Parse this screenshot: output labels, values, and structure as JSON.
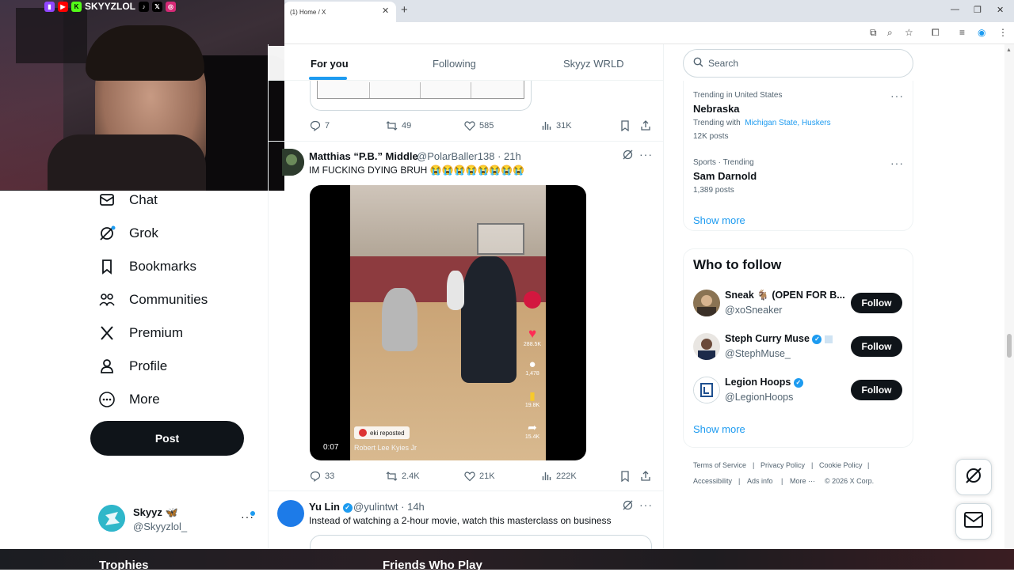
{
  "browser": {
    "tab_title": "(1) Home / X",
    "close_glyph": "✕",
    "new_tab_glyph": "+"
  },
  "stream_overlay": {
    "channel": "SKYYZLOL"
  },
  "nav": {
    "items": [
      {
        "label": "Chat",
        "icon": "chat-icon"
      },
      {
        "label": "Grok",
        "icon": "grok-icon"
      },
      {
        "label": "Bookmarks",
        "icon": "bookmark-icon"
      },
      {
        "label": "Communities",
        "icon": "communities-icon"
      },
      {
        "label": "Premium",
        "icon": "x-logo-icon"
      },
      {
        "label": "Profile",
        "icon": "profile-icon"
      },
      {
        "label": "More",
        "icon": "more-circle-icon"
      }
    ],
    "post_label": "Post",
    "account": {
      "name": "Skyyz 🦋",
      "handle": "@Skyyzlol_"
    }
  },
  "feed": {
    "tabs": [
      "For you",
      "Following",
      "Skyyz WRLD"
    ],
    "active_tab": "For you",
    "prev_post_stats": {
      "replies": "7",
      "reposts": "49",
      "likes": "585",
      "views": "31K"
    },
    "post1": {
      "author": "Matthias “P.B.” Middle",
      "handle": "@PolarBaller138 · 21h",
      "text": "IM FUCKING DYING BRUH 😭😭😭😭😭😭😭😭",
      "video": {
        "time": "0:07",
        "repost_label": "eki reposted",
        "caption": "Robert Lee Kyies Jr",
        "likes": "288.5K",
        "comments": "1,478",
        "saves": "19.8K",
        "shares": "15.4K"
      },
      "stats": {
        "replies": "33",
        "reposts": "2.4K",
        "likes": "21K",
        "views": "222K"
      }
    },
    "post2": {
      "author": "Yu Lin",
      "handle": "@yulintwt · 14h",
      "text": "Instead of watching a 2-hour movie, watch this masterclass on business"
    }
  },
  "sidebar": {
    "search_placeholder": "Search",
    "trends": [
      {
        "category": "Trending in United States",
        "name": "Nebraska",
        "meta_prefix": "Trending with",
        "meta_links": "Michigan State, Huskers",
        "posts": "12K posts"
      },
      {
        "category": "Sports · Trending",
        "name": "Sam Darnold",
        "posts": "1,389 posts"
      }
    ],
    "show_more": "Show more",
    "who_to_follow": {
      "title": "Who to follow",
      "people": [
        {
          "name": "Sneak 🐐 (OPEN FOR B...",
          "handle": "@xoSneaker",
          "verified": false
        },
        {
          "name": "Steph Curry Muse",
          "handle": "@StephMuse_",
          "verified": true
        },
        {
          "name": "Legion Hoops",
          "handle": "@LegionHoops",
          "verified": true
        }
      ],
      "follow_label": "Follow",
      "show_more": "Show more"
    },
    "footer": {
      "row1": [
        "Terms of Service",
        "Privacy Policy",
        "Cookie Policy"
      ],
      "row2": [
        "Accessibility",
        "Ads info",
        "More ···",
        "© 2026 X Corp."
      ]
    }
  },
  "bottom_bar": {
    "left": "Trophies",
    "right": "Friends Who Play"
  },
  "colors": {
    "accent": "#1d9bf0",
    "text": "#0f1419",
    "muted": "#536471"
  }
}
